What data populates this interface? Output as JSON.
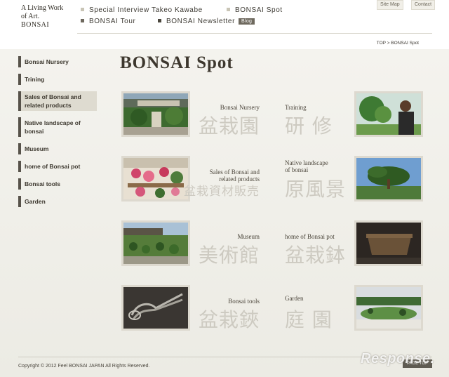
{
  "logo": {
    "line1": "A Living Work",
    "line2": "of Art.",
    "brand": "BONSAI"
  },
  "topnav": {
    "items": [
      {
        "label": "Special Interview Takeo Kawabe"
      },
      {
        "label": "BONSAI Spot"
      },
      {
        "label": "BONSAI Tour"
      },
      {
        "label": "BONSAI Newsletter"
      }
    ],
    "blog_badge": "Blog"
  },
  "util": {
    "site_map": "Site Map",
    "contact": "Contact"
  },
  "breadcrumb": "TOP > BONSAI Spot",
  "sidebar": {
    "items": [
      {
        "label": "Bonsai Nursery"
      },
      {
        "label": "Trining"
      },
      {
        "label": "Sales of Bonsai and related products"
      },
      {
        "label": "Native landscape of bonsai"
      },
      {
        "label": "Museum"
      },
      {
        "label": "home of Bonsai pot"
      },
      {
        "label": "Bonsai tools"
      },
      {
        "label": "Garden"
      }
    ]
  },
  "page_title": "BONSAI Spot",
  "spots": [
    {
      "en": "Bonsai Nursery",
      "jp": "盆栽園"
    },
    {
      "en": "Training",
      "jp": "研 修"
    },
    {
      "en": "Sales of Bonsai and\nrelated products",
      "jp": "盆栽資材販売"
    },
    {
      "en": "Native landscape\nof bonsai",
      "jp": "原風景"
    },
    {
      "en": "Museum",
      "jp": "美術館"
    },
    {
      "en": "home of Bonsai pot",
      "jp": "盆栽鉢"
    },
    {
      "en": "Bonsai tools",
      "jp": "盆栽鋏"
    },
    {
      "en": "Garden",
      "jp": "庭 園"
    }
  ],
  "footer": {
    "copyright": "Copyright © 2012 Feel BONSAI JAPAN All Rights Reserved.",
    "pagetop": "PAGE TOP"
  },
  "watermark": "Response."
}
